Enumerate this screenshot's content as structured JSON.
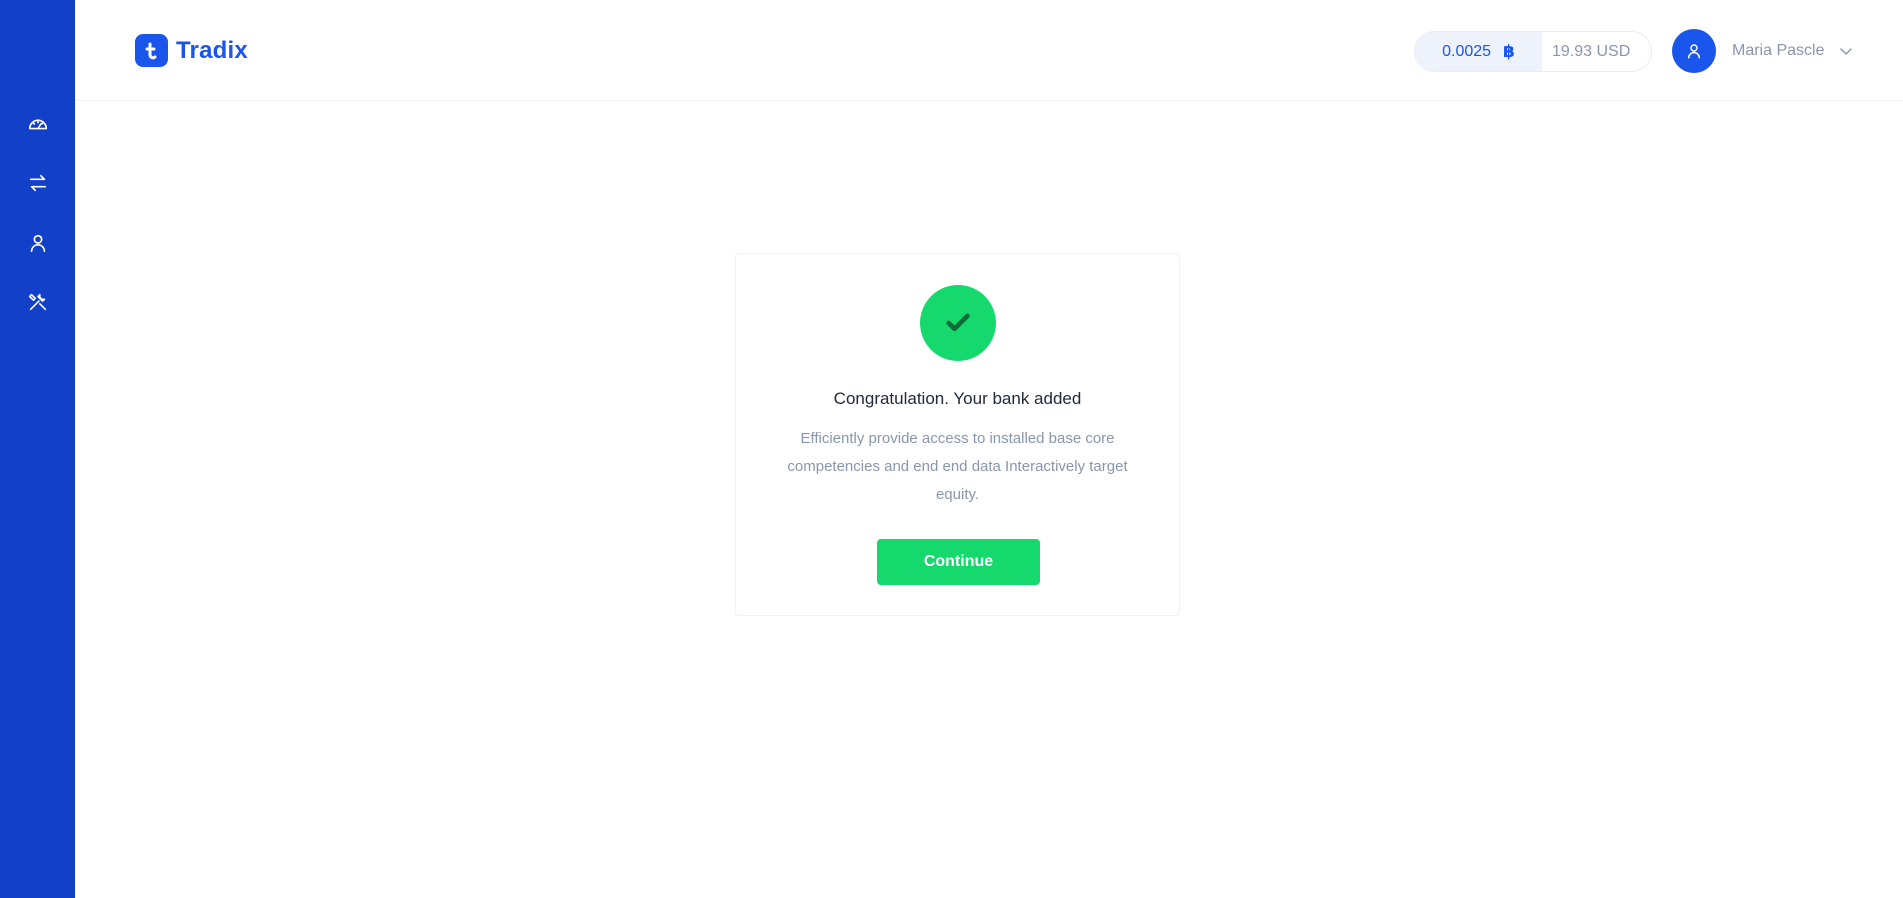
{
  "brand": {
    "name": "Tradix",
    "color": "#1a55ec"
  },
  "sidebar": {
    "background": "#1240c9",
    "items": [
      {
        "icon": "dashboard-gauge-icon"
      },
      {
        "icon": "exchange-arrows-icon"
      },
      {
        "icon": "user-icon"
      },
      {
        "icon": "settings-tools-icon"
      }
    ]
  },
  "header": {
    "balance": {
      "crypto_amount": "0.0025",
      "crypto_symbol": "฿",
      "fiat_amount": "19.93 USD"
    },
    "user": {
      "name": "Maria Pascle",
      "avatar_icon": "user-icon"
    }
  },
  "card": {
    "icon": "check-icon",
    "title": "Congratulation. Your bank added",
    "description": "Efficiently provide access to installed base core competencies and end end data Interactively target equity.",
    "button_label": "Continue",
    "accent": "#16d96e"
  }
}
